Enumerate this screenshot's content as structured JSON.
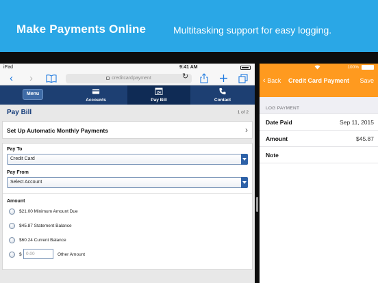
{
  "banner": {
    "title": "Make Payments Online",
    "subtitle": "Multitasking support for easy logging."
  },
  "left": {
    "status": {
      "carrier": "iPad",
      "time": "9:41 AM"
    },
    "safari": {
      "back": "‹",
      "forward": "›",
      "url": "creditcardpayment",
      "reload": "↻"
    },
    "tabs": {
      "menu": "Menu",
      "accounts": "Accounts",
      "paybill": "Pay Bill",
      "paybill_icon_num": "24",
      "contact": "Contact"
    },
    "page": {
      "title": "Pay Bill",
      "pager": "1 of 2"
    },
    "autopay": {
      "label": "Set Up Automatic Monthly Payments",
      "chevron": "›"
    },
    "form": {
      "pay_to_label": "Pay To",
      "pay_to_value": "Credit Card",
      "pay_from_label": "Pay From",
      "pay_from_value": "Select Account",
      "amount_label": "Amount",
      "options": [
        "$21.00 Minimum Amount Due",
        "$45.87 Statement Balance",
        "$60.24 Current Balance"
      ],
      "other_prefix": "$",
      "other_placeholder": "0.00",
      "other_label": "Other Amount"
    }
  },
  "right": {
    "status": {
      "battery": "100%"
    },
    "nav": {
      "back": "Back",
      "title": "Credit Card Payment",
      "save": "Save"
    },
    "section": "LOG PAYMENT",
    "fields": [
      {
        "key": "Date Paid",
        "value": "Sep 11, 2015"
      },
      {
        "key": "Amount",
        "value": "$45.87"
      },
      {
        "key": "Note",
        "value": ""
      }
    ]
  },
  "colors": {
    "banner": "#2aa7e6",
    "tabbar": "#1d3f72",
    "accent_orange": "#ff9a1f",
    "title_blue": "#123a78"
  }
}
